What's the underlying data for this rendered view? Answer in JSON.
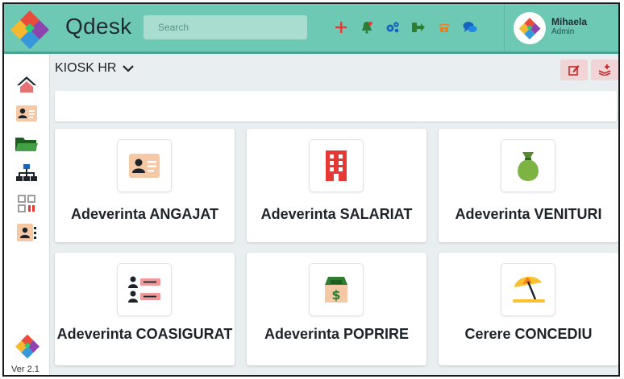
{
  "app": {
    "title": "Qdesk",
    "version": "Ver 2.1"
  },
  "search": {
    "placeholder": "Search"
  },
  "toolbar": {
    "icons": [
      "add-icon",
      "bell-icon",
      "settings-icon",
      "logout-icon",
      "phone-icon",
      "chat-icon"
    ],
    "colors": {
      "add": "#e53935",
      "bell": "#2e7d32",
      "settings": "#1565c0",
      "logout": "#2e7d32",
      "phone": "#e67e22",
      "chat": "#1565c0"
    }
  },
  "user": {
    "name": "Mihaela",
    "role": "Admin"
  },
  "sidebar": {
    "items": [
      "home-icon",
      "id-card-icon",
      "folder-icon",
      "org-chart-icon",
      "qr-code-icon",
      "contact-list-icon"
    ]
  },
  "header": {
    "title": "KIOSK HR"
  },
  "cards": [
    {
      "label": "Adeverinta ANGAJAT",
      "icon": "id-card-icon"
    },
    {
      "label": "Adeverinta SALARIAT",
      "icon": "building-icon"
    },
    {
      "label": "Adeverinta VENITURI",
      "icon": "money-bag-icon"
    },
    {
      "label": "Adeverinta COASIGURAT",
      "icon": "contact-list-icon"
    },
    {
      "label": "Adeverinta POPRIRE",
      "icon": "cash-box-icon"
    },
    {
      "label": "Cerere CONCEDIU",
      "icon": "beach-umbrella-icon"
    }
  ],
  "colors": {
    "topbar": "#6ec9b4",
    "background": "#e9eef1",
    "accent_pink": "#f0d4d6"
  }
}
